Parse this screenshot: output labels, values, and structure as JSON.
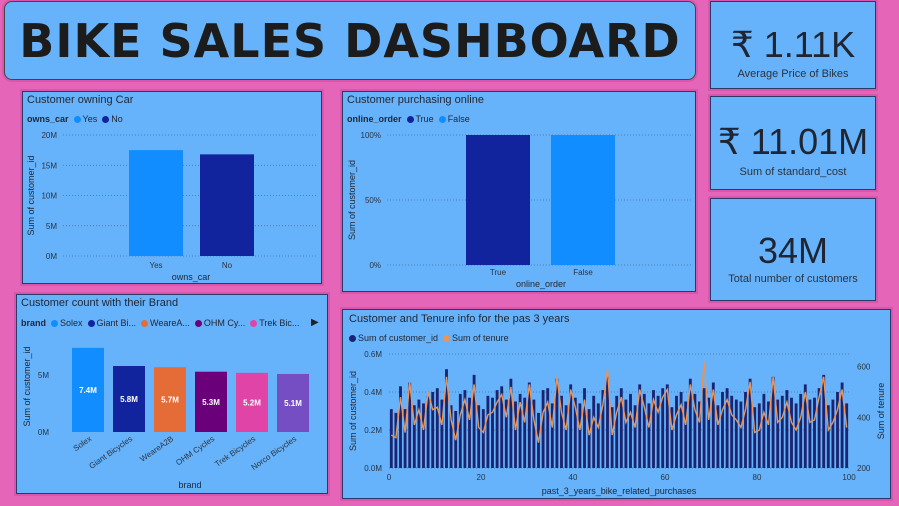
{
  "header": {
    "title": "BIKE SALES DASHBOARD"
  },
  "kpis": [
    {
      "value": "₹ 1.11K",
      "label": "Average Price of Bikes"
    },
    {
      "value": "₹ 11.01M",
      "label": "Sum of standard_cost"
    },
    {
      "value": "34M",
      "label": "Total number of customers"
    }
  ],
  "colors": {
    "light_blue": "#118dff",
    "dark_blue": "#12239e",
    "orange": "#e66c37",
    "purple": "#6b007b",
    "pink": "#e044a7",
    "violet": "#744ec2",
    "line": "#e8945a",
    "bar_dark": "#1a2470"
  },
  "owns_car": {
    "title": "Customer owning Car",
    "legend_title": "owns_car",
    "legend": [
      "Yes",
      "No"
    ],
    "chart_data": {
      "type": "bar",
      "categories": [
        "Yes",
        "No"
      ],
      "values": [
        17.5,
        16.8
      ],
      "ylim": [
        0,
        20
      ],
      "yticks": [
        "0M",
        "5M",
        "10M",
        "15M",
        "20M"
      ],
      "xlabel": "owns_car",
      "ylabel": "Sum of customer_id"
    }
  },
  "online": {
    "title": "Customer purchasing online",
    "legend_title": "online_order",
    "legend": [
      "True",
      "False"
    ],
    "chart_data": {
      "type": "bar",
      "categories": [
        "True",
        "False"
      ],
      "values": [
        100,
        100
      ],
      "ylim": [
        0,
        100
      ],
      "yticks": [
        "0%",
        "50%",
        "100%"
      ],
      "xlabel": "online_order",
      "ylabel": "Sum of customer_id"
    }
  },
  "brand": {
    "title": "Customer count with their Brand",
    "legend_title": "brand",
    "legend": [
      "Solex",
      "Giant Bi...",
      "WeareA...",
      "OHM Cy...",
      "Trek Bic..."
    ],
    "chart_data": {
      "type": "bar",
      "categories": [
        "Solex",
        "Giant Bicycles",
        "WeareA2B",
        "OHM Cycles",
        "Trek Bicycles",
        "Norco Bicycles"
      ],
      "values": [
        7.4,
        5.8,
        5.7,
        5.3,
        5.2,
        5.1
      ],
      "labels": [
        "7.4M",
        "5.8M",
        "5.7M",
        "5.3M",
        "5.2M",
        "5.1M"
      ],
      "ylim": [
        0,
        8
      ],
      "yticks": [
        "0M",
        "5M"
      ],
      "xlabel": "brand",
      "ylabel": "Sum of customer_id"
    }
  },
  "tenure": {
    "title": "Customer and Tenure info for the pas 3 years",
    "legend": [
      "Sum of customer_id",
      "Sum of tenure"
    ],
    "chart_data": {
      "type": "bar",
      "xlabel": "past_3_years_bike_related_purchases",
      "ylabel": "Sum of customer_id",
      "ylabel2": "Sum of tenure",
      "xticks": [
        "0",
        "20",
        "40",
        "60",
        "80",
        "100"
      ],
      "yticks": [
        "0.0M",
        "0.2M",
        "0.4M",
        "0.6M"
      ],
      "y2ticks": [
        "200",
        "400",
        "600"
      ],
      "ylim": [
        0,
        0.6
      ],
      "y2lim": [
        200,
        650
      ],
      "x": [
        0,
        1,
        2,
        3,
        4,
        5,
        6,
        7,
        8,
        9,
        10,
        11,
        12,
        13,
        14,
        15,
        16,
        17,
        18,
        19,
        20,
        21,
        22,
        23,
        24,
        25,
        26,
        27,
        28,
        29,
        30,
        31,
        32,
        33,
        34,
        35,
        36,
        37,
        38,
        39,
        40,
        41,
        42,
        43,
        44,
        45,
        46,
        47,
        48,
        49,
        50,
        51,
        52,
        53,
        54,
        55,
        56,
        57,
        58,
        59,
        60,
        61,
        62,
        63,
        64,
        65,
        66,
        67,
        68,
        69,
        70,
        71,
        72,
        73,
        74,
        75,
        76,
        77,
        78,
        79,
        80,
        81,
        82,
        83,
        84,
        85,
        86,
        87,
        88,
        89,
        90,
        91,
        92,
        93,
        94,
        95,
        96,
        97,
        98,
        99
      ],
      "series": [
        {
          "name": "Sum of customer_id",
          "values": [
            0.31,
            0.29,
            0.43,
            0.31,
            0.45,
            0.33,
            0.36,
            0.34,
            0.38,
            0.4,
            0.42,
            0.36,
            0.52,
            0.33,
            0.3,
            0.39,
            0.41,
            0.37,
            0.49,
            0.33,
            0.31,
            0.38,
            0.37,
            0.41,
            0.43,
            0.36,
            0.47,
            0.35,
            0.39,
            0.37,
            0.45,
            0.36,
            0.29,
            0.41,
            0.42,
            0.34,
            0.47,
            0.38,
            0.33,
            0.44,
            0.37,
            0.34,
            0.42,
            0.31,
            0.38,
            0.34,
            0.41,
            0.48,
            0.32,
            0.38,
            0.42,
            0.36,
            0.39,
            0.33,
            0.44,
            0.39,
            0.34,
            0.41,
            0.38,
            0.42,
            0.44,
            0.32,
            0.38,
            0.4,
            0.35,
            0.47,
            0.39,
            0.35,
            0.42,
            0.37,
            0.45,
            0.33,
            0.4,
            0.42,
            0.38,
            0.36,
            0.35,
            0.4,
            0.47,
            0.32,
            0.34,
            0.39,
            0.35,
            0.48,
            0.36,
            0.38,
            0.41,
            0.37,
            0.34,
            0.39,
            0.44,
            0.36,
            0.37,
            0.42,
            0.49,
            0.33,
            0.36,
            0.4,
            0.45,
            0.34
          ]
        },
        {
          "name": "Sum of tenure",
          "values": [
            330,
            320,
            480,
            340,
            540,
            370,
            430,
            350,
            500,
            430,
            440,
            370,
            560,
            390,
            310,
            410,
            470,
            390,
            530,
            360,
            340,
            410,
            420,
            460,
            490,
            400,
            520,
            350,
            460,
            380,
            530,
            390,
            300,
            420,
            460,
            360,
            560,
            420,
            350,
            510,
            440,
            350,
            470,
            330,
            400,
            360,
            450,
            590,
            330,
            420,
            480,
            380,
            420,
            360,
            510,
            440,
            360,
            470,
            420,
            480,
            510,
            350,
            410,
            450,
            370,
            530,
            430,
            380,
            620,
            390,
            510,
            370,
            430,
            470,
            410,
            390,
            360,
            430,
            540,
            340,
            350,
            420,
            370,
            560,
            380,
            400,
            460,
            380,
            350,
            400,
            500,
            380,
            390,
            480,
            560,
            350,
            380,
            430,
            510,
            360
          ]
        }
      ]
    }
  }
}
